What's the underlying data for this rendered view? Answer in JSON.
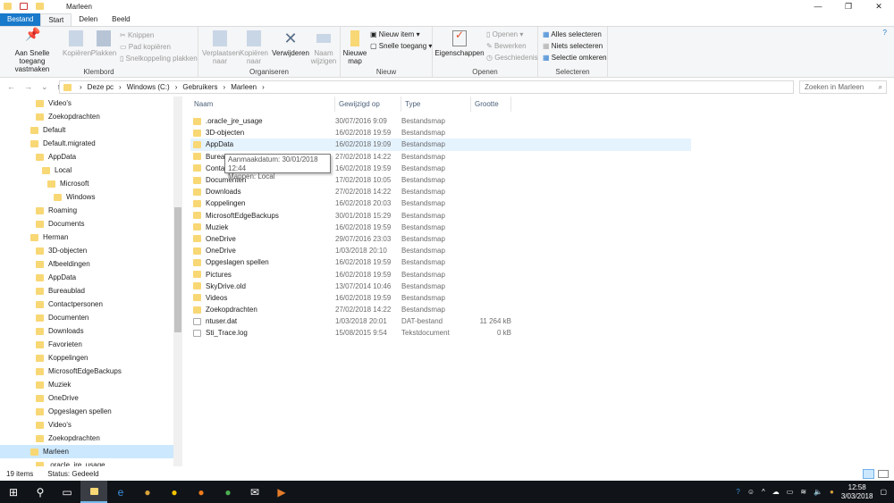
{
  "window": {
    "title": "Marleen",
    "controls": [
      "—",
      "❐",
      "✕"
    ]
  },
  "tabs": [
    "Bestand",
    "Start",
    "Delen",
    "Beeld"
  ],
  "ribbon": {
    "klembord": {
      "label": "Klembord",
      "pin": "Aan Snelle toegang vastmaken",
      "copy": "Kopiëren",
      "paste": "Plakken",
      "cut": "Knippen",
      "copypath": "Pad kopiëren",
      "pasteshortcut": "Snelkoppeling plakken"
    },
    "organiseren": {
      "label": "Organiseren",
      "move": "Verplaatsen naar",
      "copyto": "Kopiëren naar",
      "delete": "Verwijderen",
      "rename": "Naam wijzigen"
    },
    "nieuw": {
      "label": "Nieuw",
      "newfolder": "Nieuwe map",
      "newitem": "Nieuw item",
      "easyaccess": "Snelle toegang"
    },
    "openen": {
      "label": "Openen",
      "props": "Eigenschappen",
      "open": "Openen",
      "edit": "Bewerken",
      "history": "Geschiedenis"
    },
    "selecteren": {
      "label": "Selecteren",
      "all": "Alles selecteren",
      "none": "Niets selecteren",
      "invert": "Selectie omkeren"
    }
  },
  "address": {
    "crumbs": [
      "Deze pc",
      "Windows (C:)",
      "Gebruikers",
      "Marleen"
    ],
    "search_placeholder": "Zoeken in Marleen"
  },
  "sidebar": [
    {
      "label": "Video's",
      "lvl": 2
    },
    {
      "label": "Zoekopdrachten",
      "lvl": 2
    },
    {
      "label": "Default",
      "lvl": 1
    },
    {
      "label": "Default.migrated",
      "lvl": 1
    },
    {
      "label": "AppData",
      "lvl": 2
    },
    {
      "label": "Local",
      "lvl": 3
    },
    {
      "label": "Microsoft",
      "lvl": 4
    },
    {
      "label": "Windows",
      "lvl": 5
    },
    {
      "label": "Roaming",
      "lvl": 2
    },
    {
      "label": "Documents",
      "lvl": 2
    },
    {
      "label": "Herman",
      "lvl": 1
    },
    {
      "label": "3D-objecten",
      "lvl": 2
    },
    {
      "label": "Afbeeldingen",
      "lvl": 2
    },
    {
      "label": "AppData",
      "lvl": 2
    },
    {
      "label": "Bureaublad",
      "lvl": 2
    },
    {
      "label": "Contactpersonen",
      "lvl": 2
    },
    {
      "label": "Documenten",
      "lvl": 2
    },
    {
      "label": "Downloads",
      "lvl": 2
    },
    {
      "label": "Favorieten",
      "lvl": 2
    },
    {
      "label": "Koppelingen",
      "lvl": 2
    },
    {
      "label": "MicrosoftEdgeBackups",
      "lvl": 2
    },
    {
      "label": "Muziek",
      "lvl": 2
    },
    {
      "label": "OneDrive",
      "lvl": 2
    },
    {
      "label": "Opgeslagen spellen",
      "lvl": 2
    },
    {
      "label": "Video's",
      "lvl": 2
    },
    {
      "label": "Zoekopdrachten",
      "lvl": 2
    },
    {
      "label": "Marleen",
      "lvl": 1,
      "selected": true
    },
    {
      "label": ".oracle_jre_usage",
      "lvl": 2
    }
  ],
  "columns": [
    "Naam",
    "Gewijzigd op",
    "Type",
    "Grootte"
  ],
  "files": [
    {
      "name": ".oracle_jre_usage",
      "date": "30/07/2016 9:09",
      "type": "Bestandsmap",
      "size": ""
    },
    {
      "name": "3D-objecten",
      "date": "16/02/2018 19:59",
      "type": "Bestandsmap",
      "size": ""
    },
    {
      "name": "AppData",
      "date": "16/02/2018 19:09",
      "type": "Bestandsmap",
      "size": ""
    },
    {
      "name": "Bureaublad",
      "date": "27/02/2018 14:22",
      "type": "Bestandsmap",
      "size": ""
    },
    {
      "name": "Contactpersonen",
      "date": "16/02/2018 19:59",
      "type": "Bestandsmap",
      "size": ""
    },
    {
      "name": "Documenten",
      "date": "17/02/2018 10:05",
      "type": "Bestandsmap",
      "size": ""
    },
    {
      "name": "Downloads",
      "date": "27/02/2018 14:22",
      "type": "Bestandsmap",
      "size": ""
    },
    {
      "name": "Koppelingen",
      "date": "16/02/2018 20:03",
      "type": "Bestandsmap",
      "size": ""
    },
    {
      "name": "MicrosoftEdgeBackups",
      "date": "30/01/2018 15:29",
      "type": "Bestandsmap",
      "size": ""
    },
    {
      "name": "Muziek",
      "date": "16/02/2018 19:59",
      "type": "Bestandsmap",
      "size": ""
    },
    {
      "name": "OneDrive",
      "date": "29/07/2016 23:03",
      "type": "Bestandsmap",
      "size": ""
    },
    {
      "name": "OneDrive",
      "date": "1/03/2018 20:10",
      "type": "Bestandsmap",
      "size": ""
    },
    {
      "name": "Opgeslagen spellen",
      "date": "16/02/2018 19:59",
      "type": "Bestandsmap",
      "size": ""
    },
    {
      "name": "Pictures",
      "date": "16/02/2018 19:59",
      "type": "Bestandsmap",
      "size": ""
    },
    {
      "name": "SkyDrive.old",
      "date": "13/07/2014 10:46",
      "type": "Bestandsmap",
      "size": ""
    },
    {
      "name": "Videos",
      "date": "16/02/2018 19:59",
      "type": "Bestandsmap",
      "size": ""
    },
    {
      "name": "Zoekopdrachten",
      "date": "27/02/2018 14:22",
      "type": "Bestandsmap",
      "size": ""
    },
    {
      "name": "ntuser.dat",
      "date": "1/03/2018 20:01",
      "type": "DAT-bestand",
      "size": "11 264 kB"
    },
    {
      "name": "Sti_Trace.log",
      "date": "15/08/2015 9:54",
      "type": "Tekstdocument",
      "size": "0 kB"
    }
  ],
  "tooltip": {
    "line1": "Aanmaakdatum: 30/01/2018 12:44",
    "line2": "Mappen: Local"
  },
  "status": {
    "count": "19 items",
    "state": "Status: Gedeeld"
  },
  "clock": {
    "time": "12:58",
    "date": "3/03/2018"
  }
}
